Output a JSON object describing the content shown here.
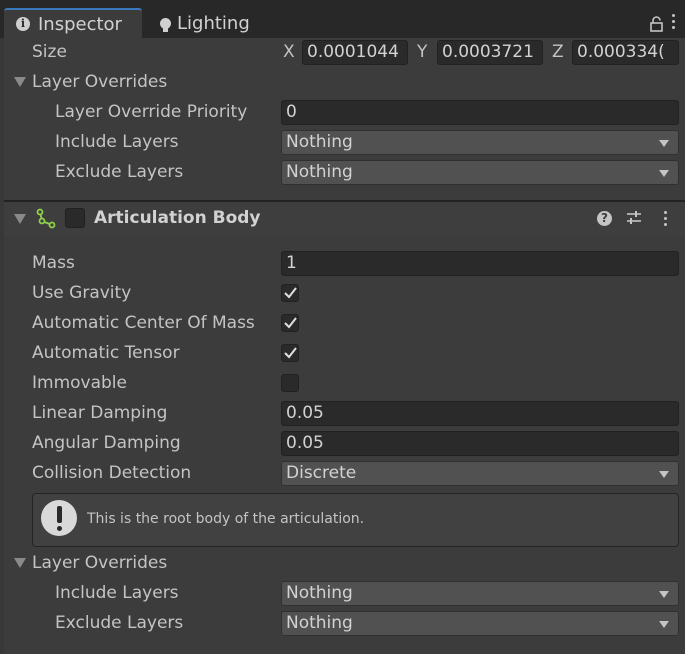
{
  "tabs": {
    "inspector": "Inspector",
    "lighting": "Lighting"
  },
  "size": {
    "label": "Size",
    "x_label": "X",
    "x_value": "0.0001044",
    "y_label": "Y",
    "y_value": "0.0003721",
    "z_label": "Z",
    "z_value": "0.000334("
  },
  "layer_overrides_top": {
    "title": "Layer Overrides",
    "priority_label": "Layer Override Priority",
    "priority_value": "0",
    "include_label": "Include Layers",
    "include_value": "Nothing",
    "exclude_label": "Exclude Layers",
    "exclude_value": "Nothing"
  },
  "component": {
    "title": "Articulation Body"
  },
  "props": {
    "mass_label": "Mass",
    "mass_value": "1",
    "use_gravity_label": "Use Gravity",
    "auto_com_label": "Automatic Center Of Mass",
    "auto_tensor_label": "Automatic Tensor",
    "immovable_label": "Immovable",
    "linear_damping_label": "Linear Damping",
    "linear_damping_value": "0.05",
    "angular_damping_label": "Angular Damping",
    "angular_damping_value": "0.05",
    "collision_label": "Collision Detection",
    "collision_value": "Discrete"
  },
  "checks": {
    "use_gravity": true,
    "auto_com": true,
    "auto_tensor": true,
    "immovable": false
  },
  "helpbox": {
    "text": "This is the root body of the articulation."
  },
  "layer_overrides_bottom": {
    "title": "Layer Overrides",
    "include_label": "Include Layers",
    "include_value": "Nothing",
    "exclude_label": "Exclude Layers",
    "exclude_value": "Nothing"
  },
  "colors": {
    "tab_accent": "#3a79bb",
    "component_icon": "#8fd24a"
  },
  "icons": [
    "info-icon",
    "lightbulb-icon",
    "lock-icon",
    "kebab-menu-icon",
    "foldout-arrow-icon",
    "articulation-body-icon",
    "help-icon",
    "preset-icon",
    "checkmark-icon",
    "dropdown-caret-icon",
    "warning-icon"
  ]
}
